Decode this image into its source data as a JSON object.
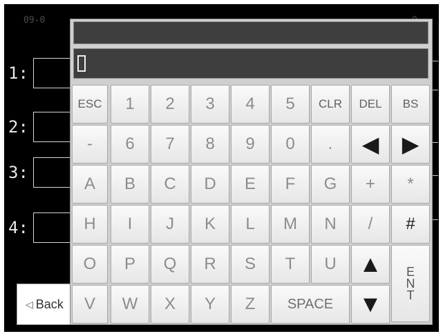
{
  "background": {
    "header_left": "09-0",
    "header_right": "0",
    "row_labels": [
      "1:",
      "2:",
      "3:",
      "4:"
    ],
    "back_label": "Back"
  },
  "keypad": {
    "rows": [
      [
        "ESC",
        "1",
        "2",
        "3",
        "4",
        "5",
        "CLR",
        "DEL",
        "BS"
      ],
      [
        "-",
        "6",
        "7",
        "8",
        "9",
        "0",
        ".",
        "left-arrow-icon",
        "right-arrow-icon"
      ],
      [
        "A",
        "B",
        "C",
        "D",
        "E",
        "F",
        "G",
        "+",
        "*"
      ],
      [
        "H",
        "I",
        "J",
        "K",
        "L",
        "M",
        "N",
        "/",
        "#"
      ],
      [
        "O",
        "P",
        "Q",
        "R",
        "S",
        "T",
        "U",
        "up-arrow-icon",
        "E N T"
      ],
      [
        "V",
        "W",
        "X",
        "Y",
        "Z",
        "SPACE",
        "down-arrow-icon"
      ]
    ],
    "ent_letters": [
      "E",
      "N",
      "T"
    ],
    "space_label": "SPACE"
  },
  "colors": {
    "screen_bg": "#000000",
    "input_bg": "#3e3e3e",
    "key_bg": "#f0f0f0",
    "keypad_bg": "#cfcfcf"
  }
}
